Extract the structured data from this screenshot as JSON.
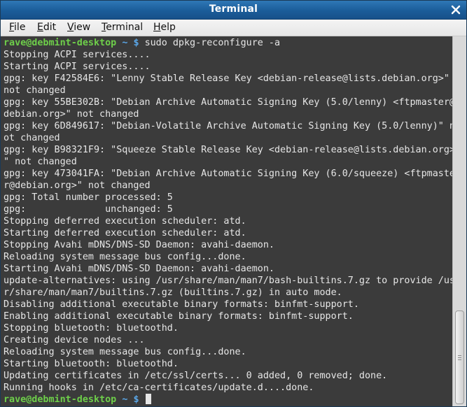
{
  "window": {
    "title": "Terminal",
    "close_icon": "close-icon"
  },
  "menu": [
    {
      "mnemonic": "F",
      "rest": "ile"
    },
    {
      "mnemonic": "E",
      "rest": "dit"
    },
    {
      "mnemonic": "V",
      "rest": "iew"
    },
    {
      "mnemonic": "T",
      "rest": "erminal"
    },
    {
      "mnemonic": "H",
      "rest": "elp"
    }
  ],
  "prompt": {
    "user_host": "rave@debmint-desktop",
    "path": "~",
    "symbol": "$"
  },
  "terminal": {
    "command": "sudo dpkg-reconfigure -a",
    "output": [
      "Stopping ACPI services....",
      "Starting ACPI services....",
      "gpg: key F42584E6: \"Lenny Stable Release Key <debian-release@lists.debian.org>\"",
      "not changed",
      "gpg: key 55BE302B: \"Debian Archive Automatic Signing Key (5.0/lenny) <ftpmaster@",
      "debian.org>\" not changed",
      "gpg: key 6D849617: \"Debian-Volatile Archive Automatic Signing Key (5.0/lenny)\" n",
      "ot changed",
      "gpg: key B98321F9: \"Squeeze Stable Release Key <debian-release@lists.debian.org>",
      "\" not changed",
      "gpg: key 473041FA: \"Debian Archive Automatic Signing Key (6.0/squeeze) <ftpmaste",
      "r@debian.org>\" not changed",
      "gpg: Total number processed: 5",
      "gpg:              unchanged: 5",
      "Stopping deferred execution scheduler: atd.",
      "Starting deferred execution scheduler: atd.",
      "Stopping Avahi mDNS/DNS-SD Daemon: avahi-daemon.",
      "Reloading system message bus config...done.",
      "Starting Avahi mDNS/DNS-SD Daemon: avahi-daemon.",
      "update-alternatives: using /usr/share/man/man7/bash-builtins.7.gz to provide /us",
      "r/share/man/man7/builtins.7.gz (builtins.7.gz) in auto mode.",
      "Disabling additional executable binary formats: binfmt-support.",
      "Enabling additional executable binary formats: binfmt-support.",
      "Stopping bluetooth: bluetoothd.",
      "Creating device nodes ...",
      "Reloading system message bus config...done.",
      "Starting bluetooth: bluetoothd.",
      "Updating certificates in /etc/ssl/certs... 0 added, 0 removed; done.",
      "Running hooks in /etc/ca-certificates/update.d....done."
    ]
  },
  "colors": {
    "titlebar": "#1b5c99",
    "terminal_bg": "#3b3b3b",
    "terminal_fg": "#e6e6e6",
    "prompt_user": "#6ecf4a",
    "prompt_path": "#5aa7e8"
  }
}
